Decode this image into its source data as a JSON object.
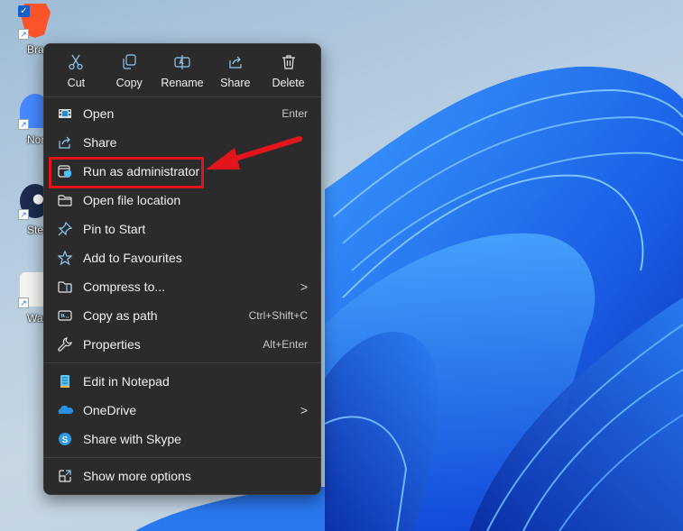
{
  "desktop": {
    "icons": [
      {
        "label": "Bra",
        "app": "Brave",
        "selected": true
      },
      {
        "label": "Nord",
        "app": "NordVPN"
      },
      {
        "label": "Stea",
        "app": "Steam"
      },
      {
        "label": "Warfr",
        "app": "Warframe"
      }
    ],
    "colors": {
      "wallpaper_blue": "#1f6fe8",
      "wallpaper_bg": "#b7cde0"
    }
  },
  "context_menu": {
    "toolbar": [
      {
        "id": "cut",
        "label": "Cut",
        "icon": "scissors-icon"
      },
      {
        "id": "copy",
        "label": "Copy",
        "icon": "copy-icon"
      },
      {
        "id": "rename",
        "label": "Rename",
        "icon": "rename-icon"
      },
      {
        "id": "share",
        "label": "Share",
        "icon": "share-icon"
      },
      {
        "id": "delete",
        "label": "Delete",
        "icon": "trash-icon"
      }
    ],
    "group1": [
      {
        "label": "Open",
        "accel": "Enter",
        "icon": "open-icon"
      },
      {
        "label": "Share",
        "accel": "",
        "icon": "share-icon"
      },
      {
        "label": "Run as administrator",
        "accel": "",
        "icon": "admin-shield-icon",
        "highlighted": true
      },
      {
        "label": "Open file location",
        "accel": "",
        "icon": "folder-icon"
      },
      {
        "label": "Pin to Start",
        "accel": "",
        "icon": "pin-icon"
      },
      {
        "label": "Add to Favourites",
        "accel": "",
        "icon": "star-icon"
      },
      {
        "label": "Compress to...",
        "accel": "",
        "icon": "zip-folder-icon",
        "submenu": true
      },
      {
        "label": "Copy as path",
        "accel": "Ctrl+Shift+C",
        "icon": "path-icon"
      },
      {
        "label": "Properties",
        "accel": "Alt+Enter",
        "icon": "wrench-icon"
      }
    ],
    "group2": [
      {
        "label": "Edit in Notepad",
        "icon": "notepad-icon"
      },
      {
        "label": "OneDrive",
        "icon": "onedrive-icon",
        "submenu": true
      },
      {
        "label": "Share with Skype",
        "icon": "skype-icon"
      }
    ],
    "group3": [
      {
        "label": "Show more options",
        "icon": "expand-icon"
      }
    ],
    "submenu_glyph": ">",
    "colors": {
      "background": "#2b2b2b",
      "text": "#f1f1f1",
      "accent": "#4cc2ff",
      "annotation": "#e1151b"
    }
  }
}
